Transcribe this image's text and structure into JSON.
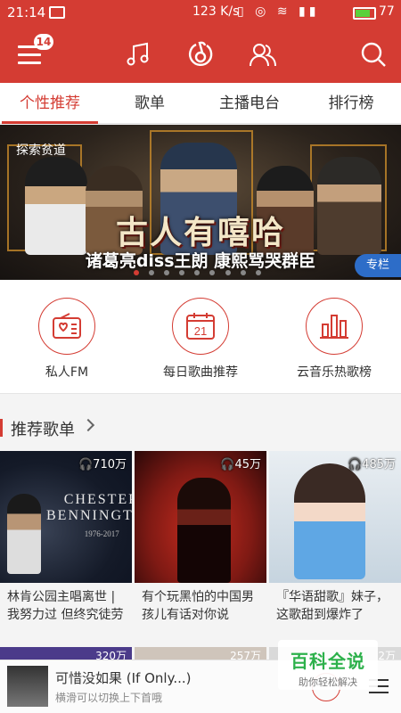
{
  "status": {
    "time": "21:14",
    "speed": "123 K/s",
    "battery": "77"
  },
  "topnav": {
    "badge": "14"
  },
  "tabs": [
    "个性推荐",
    "歌单",
    "主播电台",
    "排行榜"
  ],
  "banner": {
    "tag": "探索贫道",
    "title": "古人有嘻哈",
    "subtitle": "诸葛亮diss王朗 康熙骂哭群臣",
    "corner": "专栏"
  },
  "quick": [
    {
      "label": "私人FM",
      "icon": "radio-icon"
    },
    {
      "label": "每日歌曲推荐",
      "icon": "calendar-icon",
      "day": "21"
    },
    {
      "label": "云音乐热歌榜",
      "icon": "chart-bars-icon"
    }
  ],
  "section": {
    "title": "推荐歌单"
  },
  "playlists": [
    {
      "count": "710万",
      "title": "林肯公园主唱离世 | 我努力过 但终究徒劳",
      "cover_text": [
        "CHESTER",
        "BENNINGTON",
        "1976-2017"
      ]
    },
    {
      "count": "45万",
      "title": "有个玩黑怕的中国男孩儿有话对你说"
    },
    {
      "count": "485万",
      "title": "『华语甜歌』妹子，这歌甜到爆炸了"
    }
  ],
  "peek_counts": [
    "320万",
    "257万",
    "2万"
  ],
  "miniplayer": {
    "song": "可惜没如果 (If Only...)",
    "hint": "横滑可以切换上下首哦"
  },
  "watermark": {
    "title": "百科全说",
    "sub": "助你轻松解决"
  }
}
